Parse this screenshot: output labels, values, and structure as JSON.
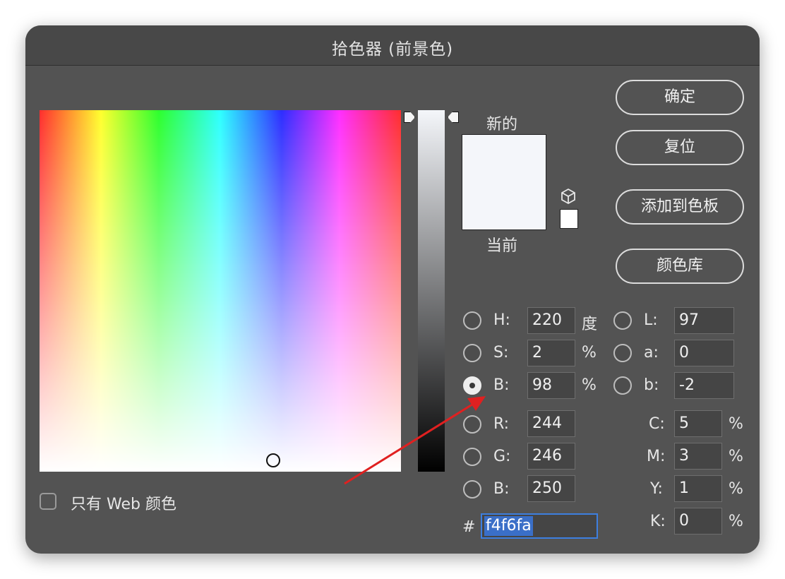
{
  "window": {
    "title": "拾色器 (前景色)"
  },
  "swatches": {
    "new_label": "新的",
    "current_label": "当前",
    "new_color": "#f4f6fa",
    "current_color": "#f4f6fa"
  },
  "buttons": {
    "ok": "确定",
    "reset": "复位",
    "add_to_swatches": "添加到色板",
    "color_libraries": "颜色库"
  },
  "hsb": [
    {
      "label": "H:",
      "value": "220",
      "unit": "度",
      "selected": false
    },
    {
      "label": "S:",
      "value": "2",
      "unit": "%",
      "selected": false
    },
    {
      "label": "B:",
      "value": "98",
      "unit": "%",
      "selected": true
    }
  ],
  "rgb": [
    {
      "label": "R:",
      "value": "244"
    },
    {
      "label": "G:",
      "value": "246"
    },
    {
      "label": "B:",
      "value": "250"
    }
  ],
  "lab": [
    {
      "label": "L:",
      "value": "97"
    },
    {
      "label": "a:",
      "value": "0"
    },
    {
      "label": "b:",
      "value": "-2"
    }
  ],
  "cmyk": [
    {
      "label": "C:",
      "value": "5",
      "unit": "%"
    },
    {
      "label": "M:",
      "value": "3",
      "unit": "%"
    },
    {
      "label": "Y:",
      "value": "1",
      "unit": "%"
    },
    {
      "label": "K:",
      "value": "0",
      "unit": "%"
    }
  ],
  "hex": {
    "prefix": "#",
    "value": "f4f6fa"
  },
  "web_only": {
    "label": "只有 Web 颜色",
    "checked": false
  },
  "colors": {
    "dialog_bg": "#535353",
    "title_bg": "#484848",
    "focus_blue": "#3d7fe0",
    "annotation_red": "#e02020"
  },
  "icons": {
    "gamut_warning": "cube-icon"
  }
}
